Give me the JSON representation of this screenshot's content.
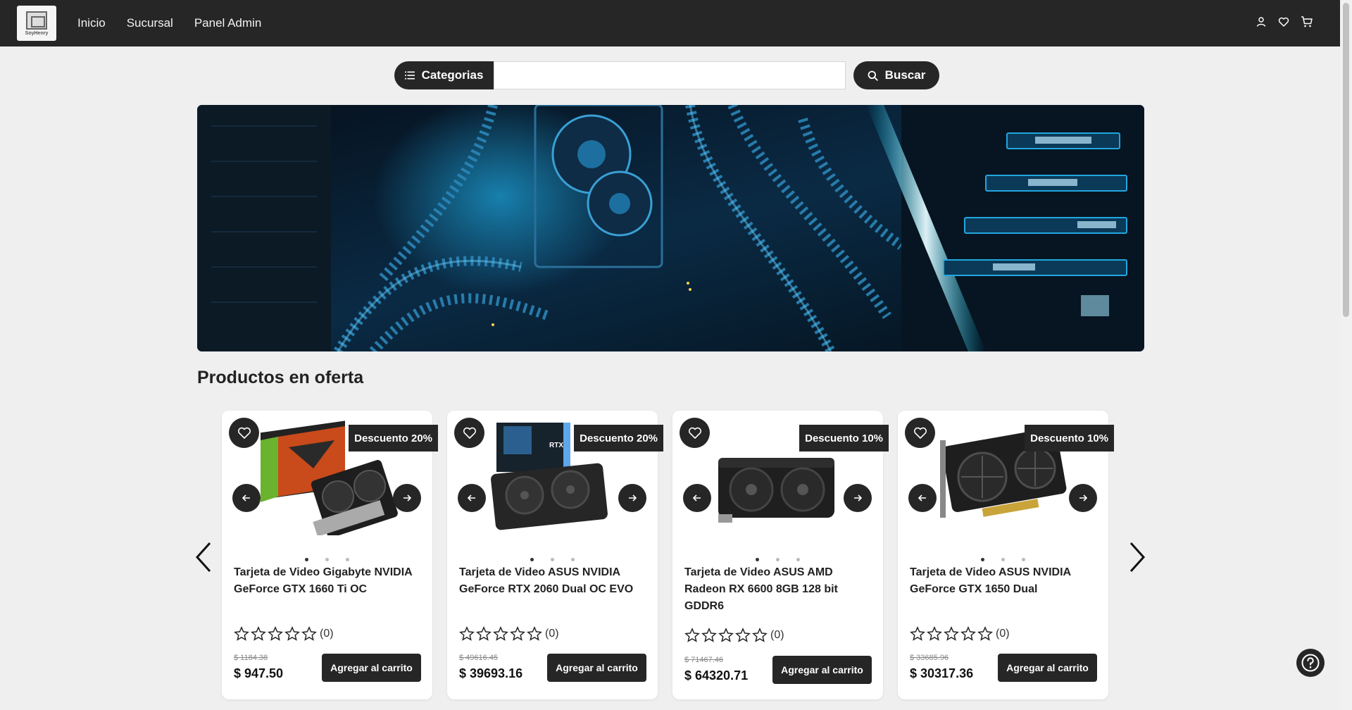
{
  "navbar": {
    "logo_text": "SoyHenry",
    "links": [
      "Inicio",
      "Sucursal",
      "Panel Admin"
    ],
    "icons": [
      "user-icon",
      "heart-icon",
      "cart-icon"
    ]
  },
  "search": {
    "categories_label": "Categorias",
    "placeholder": "",
    "button_label": "Buscar"
  },
  "banner": {
    "image": "pc-internals-blue-neon"
  },
  "section": {
    "title": "Productos en oferta"
  },
  "products": [
    {
      "discount": "Descuento 20%",
      "name": "Tarjeta de Video Gigabyte NVIDIA GeForce GTX 1660 Ti OC",
      "rating": 0,
      "reviews": "(0)",
      "old_price": "$ 1184.38",
      "price": "$ 947.50",
      "button": "Agregar al carrito",
      "active_dot": 1
    },
    {
      "discount": "Descuento 20%",
      "name": "Tarjeta de Video ASUS NVIDIA GeForce RTX 2060 Dual OC EVO",
      "rating": 0,
      "reviews": "(0)",
      "old_price": "$ 49616.45",
      "price": "$ 39693.16",
      "button": "Agregar al carrito",
      "active_dot": 1
    },
    {
      "discount": "Descuento 10%",
      "name": "Tarjeta de Video ASUS AMD Radeon RX 6600 8GB 128 bit GDDR6",
      "rating": 0,
      "reviews": "(0)",
      "old_price": "$ 71467.46",
      "price": "$ 64320.71",
      "button": "Agregar al carrito",
      "active_dot": 1
    },
    {
      "discount": "Descuento 10%",
      "name": "Tarjeta de Video ASUS NVIDIA GeForce GTX 1650 Dual",
      "rating": 0,
      "reviews": "(0)",
      "old_price": "$ 33685.96",
      "price": "$ 30317.36",
      "button": "Agregar al carrito",
      "active_dot": 1
    }
  ],
  "colors": {
    "dark": "#262626",
    "background": "#efefef",
    "card": "#ffffff",
    "accent_cyan": "#00b7ff"
  }
}
